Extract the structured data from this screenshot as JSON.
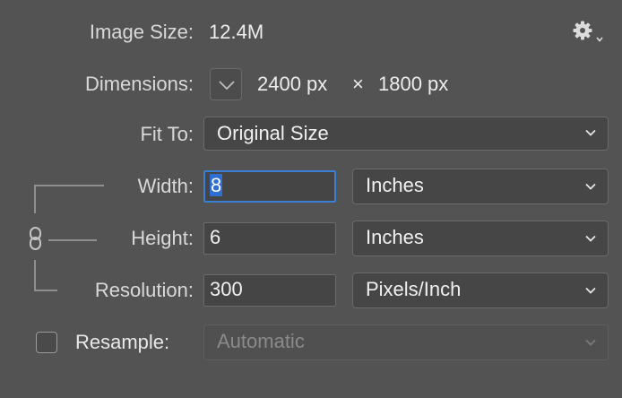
{
  "image_size": {
    "label": "Image Size:",
    "value": "12.4M"
  },
  "settings": {
    "icon": "gear-icon"
  },
  "dimensions": {
    "label": "Dimensions:",
    "width_value": "2400 px",
    "separator": "×",
    "height_value": "1800 px"
  },
  "fit_to": {
    "label": "Fit To:",
    "selected": "Original Size"
  },
  "width": {
    "label": "Width:",
    "value": "8",
    "unit": "Inches"
  },
  "height": {
    "label": "Height:",
    "value": "6",
    "unit": "Inches"
  },
  "resolution": {
    "label": "Resolution:",
    "value": "300",
    "unit": "Pixels/Inch"
  },
  "resample": {
    "label": "Resample:",
    "checked": false,
    "selected": "Automatic"
  }
}
